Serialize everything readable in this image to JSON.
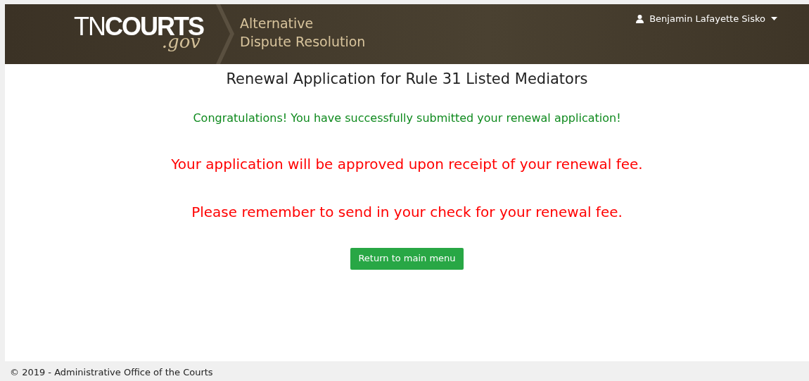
{
  "header": {
    "logo": {
      "prefix": "TN",
      "name": "COURTS",
      "suffix": ".gov"
    },
    "site_title": [
      "Alternative",
      "Dispute Resolution"
    ],
    "user_menu": {
      "name": "Benjamin Lafayette Sisko"
    }
  },
  "page": {
    "title": "Renewal Application for Rule 31 Listed Mediators",
    "messages": [
      {
        "kind": "success",
        "text": "Congratulations! You have successfully submitted your renewal application!"
      },
      {
        "kind": "warning",
        "text": "Your application will be approved upon receipt of your renewal fee."
      },
      {
        "kind": "warning",
        "text": "Please remember to send in your check for your renewal fee."
      }
    ],
    "button": "Return to main menu"
  },
  "footer": {
    "text": "© 2019 - Administrative Office of the Courts"
  }
}
